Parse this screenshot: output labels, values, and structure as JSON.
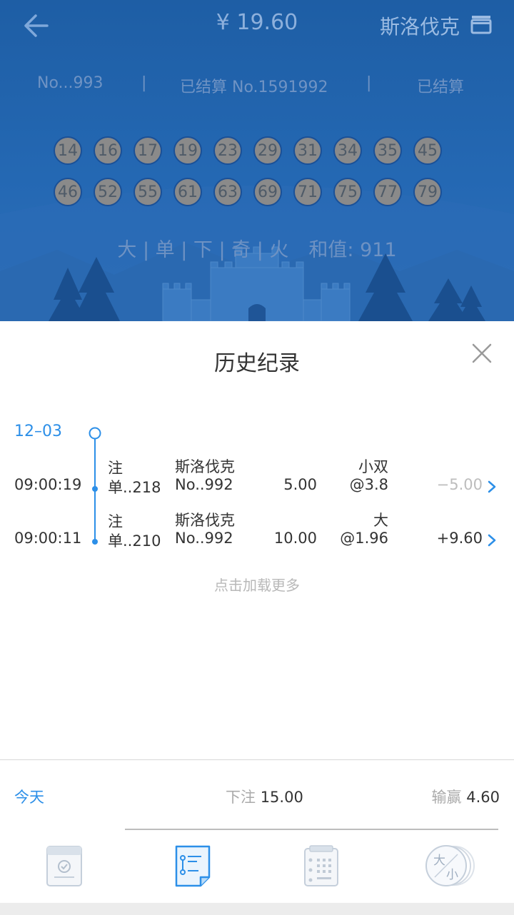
{
  "header": {
    "balance": "¥ 19.60",
    "game_name": "斯洛伐克",
    "info": {
      "issue": "No...993",
      "sep1": "|",
      "settled_issue": "已结算 No.1591992",
      "sep2": "|",
      "status": "已结算"
    },
    "balls_row1": [
      "14",
      "16",
      "17",
      "19",
      "23",
      "29",
      "31",
      "34",
      "35",
      "45"
    ],
    "balls_row2": [
      "46",
      "52",
      "55",
      "61",
      "63",
      "69",
      "71",
      "75",
      "77",
      "79"
    ],
    "attributes": "大 | 单 | 下 | 奇 | 火",
    "sum": "和值: 911"
  },
  "history": {
    "title": "历史纪录",
    "date": "12–03",
    "records": [
      {
        "time": "09:00:19",
        "label_top": "注",
        "label_bottom": "单..218",
        "game": "斯洛伐克",
        "issue": "No..992",
        "stake": "5.00",
        "bet": "小双",
        "odds": "@3.8",
        "result": "−5.00",
        "win": false
      },
      {
        "time": "09:00:11",
        "label_top": "注",
        "label_bottom": "单..210",
        "game": "斯洛伐克",
        "issue": "No..992",
        "stake": "10.00",
        "bet": "大",
        "odds": "@1.96",
        "result": "+9.60",
        "win": true
      }
    ],
    "load_more": "点击加载更多"
  },
  "summary": {
    "today": "今天",
    "bet_label": "下注",
    "bet_value": "15.00",
    "win_label": "输赢",
    "win_value": "4.60"
  },
  "tabs": [
    {
      "icon": "bet-slip-icon"
    },
    {
      "icon": "records-list-icon",
      "active": true
    },
    {
      "icon": "calendar-results-icon"
    },
    {
      "icon": "big-small-trend-icon",
      "text_top": "大",
      "text_bottom": "小"
    }
  ],
  "colors": {
    "header_bg": "#2468b3",
    "accent": "#2c8fe8",
    "ball": "#8a8a8a"
  }
}
